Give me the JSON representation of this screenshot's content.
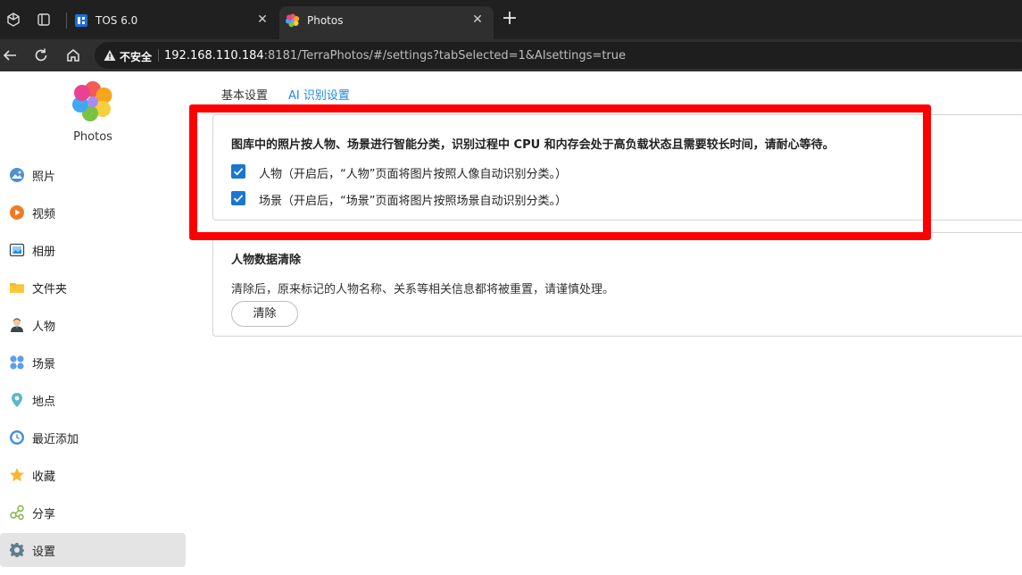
{
  "browser": {
    "tabs": [
      {
        "title": "TOS 6.0",
        "active": false
      },
      {
        "title": "Photos",
        "active": true
      }
    ],
    "security_label": "不安全",
    "url_host": "192.168.110.184",
    "url_rest": ":8181/TerraPhotos/#/settings?tabSelected=1&AIsettings=true"
  },
  "sidebar": {
    "app_name": "Photos",
    "items": [
      {
        "label": "照片",
        "icon": "photo-icon"
      },
      {
        "label": "视频",
        "icon": "video-icon"
      },
      {
        "label": "相册",
        "icon": "album-icon"
      },
      {
        "label": "文件夹",
        "icon": "folder-icon"
      },
      {
        "label": "人物",
        "icon": "person-icon"
      },
      {
        "label": "场景",
        "icon": "scene-icon"
      },
      {
        "label": "地点",
        "icon": "location-icon"
      },
      {
        "label": "最近添加",
        "icon": "recent-icon"
      },
      {
        "label": "收藏",
        "icon": "star-icon"
      },
      {
        "label": "分享",
        "icon": "share-icon"
      },
      {
        "label": "设置",
        "icon": "gear-icon",
        "selected": true
      }
    ]
  },
  "settings": {
    "tabs": [
      {
        "label": "基本设置",
        "active": false
      },
      {
        "label": "AI 识别设置",
        "active": true
      }
    ],
    "ai_card": {
      "title": "图库中的照片按人物、场景进行智能分类，识别过程中 CPU 和内存会处于高负载状态且需要较长时间，请耐心等待。",
      "options": [
        {
          "label": "人物（开启后，“人物”页面将图片按照人像自动识别分类。）",
          "checked": true
        },
        {
          "label": "场景（开启后，“场景”页面将图片按照场景自动识别分类。）",
          "checked": true
        }
      ]
    },
    "clear_card": {
      "title": "人物数据清除",
      "description": "清除后，原来标记的人物名称、关系等相关信息都将被重置，请谨慎处理。",
      "button": "清除"
    }
  },
  "colors": {
    "accent": "#1e88e5",
    "checkbox": "#1976d2",
    "highlight": "#ff0000"
  }
}
